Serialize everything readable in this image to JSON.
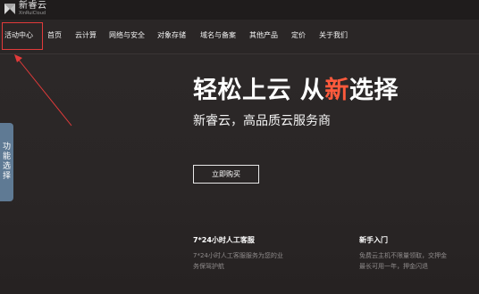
{
  "brand": {
    "name": "新睿云",
    "sub": "XinRuiCloud"
  },
  "nav": {
    "items": [
      {
        "label": "活动中心"
      },
      {
        "label": "首页"
      },
      {
        "label": "云计算"
      },
      {
        "label": "网络与安全"
      },
      {
        "label": "对象存储"
      },
      {
        "label": "域名与备案"
      },
      {
        "label": "其他产品"
      },
      {
        "label": "定价"
      },
      {
        "label": "关于我们"
      }
    ]
  },
  "hero": {
    "headline_part1": "轻松上云 从",
    "headline_accent": "新",
    "headline_part2": "选择",
    "subhead": "新睿云，高品质云服务商",
    "button_label": "立即购买"
  },
  "features": [
    {
      "title": "7*24小时人工客服",
      "desc_line1": "7*24小时人工客服服务为您的业",
      "desc_line2": "务保驾护航"
    },
    {
      "title": "新手入门",
      "desc_line1": "免费云主机不限量领取，交押金",
      "desc_line2": "最长可用一年，押金闪退"
    }
  ],
  "side_tab": {
    "label": "功能选择"
  },
  "colors": {
    "accent": "#ff5a3c",
    "annotation": "#e23a3a",
    "side_tab": "#5f7a94"
  }
}
